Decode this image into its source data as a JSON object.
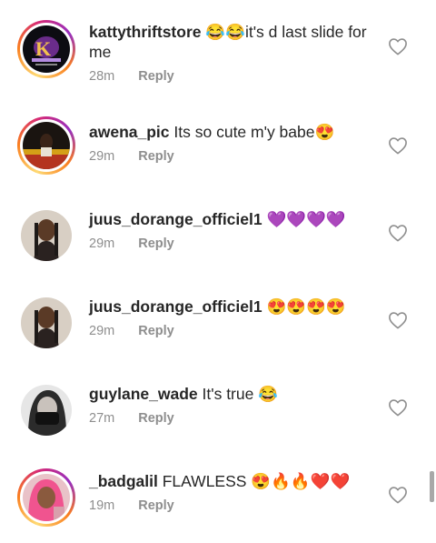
{
  "comments": [
    {
      "username": "kattythriftstore",
      "text": "😂😂it's d last slide for me",
      "time": "28m",
      "reply": "Reply"
    },
    {
      "username": "awena_pic",
      "text": "Its so cute m'y babe😍",
      "time": "29m",
      "reply": "Reply"
    },
    {
      "username": "juus_dorange_officiel1",
      "text": "💜💜💜💜",
      "time": "29m",
      "reply": "Reply"
    },
    {
      "username": "juus_dorange_officiel1",
      "text": "😍😍😍😍",
      "time": "29m",
      "reply": "Reply"
    },
    {
      "username": "guylane_wade",
      "text": "It's true 😂",
      "time": "27m",
      "reply": "Reply"
    },
    {
      "username": "_badgalil",
      "text": "FLAWLESS 😍🔥🔥❤️❤️",
      "time": "19m",
      "reply": "Reply"
    }
  ],
  "colors": {
    "story_ring": "#d62976",
    "muted": "#8e8e8e",
    "text": "#262626"
  },
  "icons": {
    "like": "heart-outline-icon"
  }
}
